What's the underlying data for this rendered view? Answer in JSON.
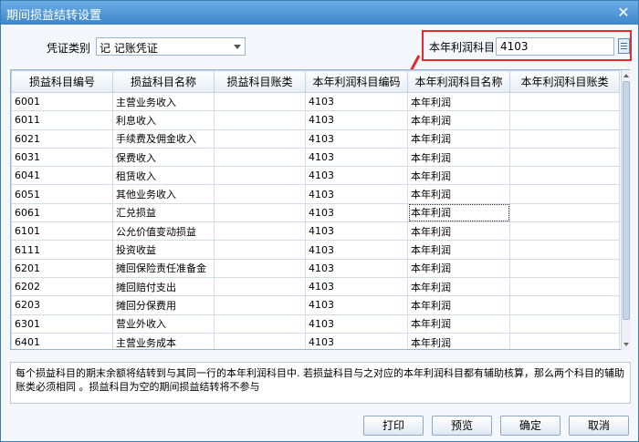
{
  "window": {
    "title": "期间损益结转设置",
    "close_glyph": "✕"
  },
  "voucher": {
    "label": "凭证类别",
    "value": "记 记账凭证"
  },
  "profit_account": {
    "label": "本年利润科目",
    "value": "4103"
  },
  "table": {
    "columns": [
      "损益科目编号",
      "损益科目名称",
      "损益科目账类",
      "本年利润科目编码",
      "本年利润科目名称",
      "本年利润科目账类"
    ],
    "rows": [
      [
        "6001",
        "主营业务收入",
        "",
        "4103",
        "本年利润",
        ""
      ],
      [
        "6011",
        "利息收入",
        "",
        "4103",
        "本年利润",
        ""
      ],
      [
        "6021",
        "手续费及佣金收入",
        "",
        "4103",
        "本年利润",
        ""
      ],
      [
        "6031",
        "保费收入",
        "",
        "4103",
        "本年利润",
        ""
      ],
      [
        "6041",
        "租赁收入",
        "",
        "4103",
        "本年利润",
        ""
      ],
      [
        "6051",
        "其他业务收入",
        "",
        "4103",
        "本年利润",
        ""
      ],
      [
        "6061",
        "汇兑损益",
        "",
        "4103",
        "本年利润",
        ""
      ],
      [
        "6101",
        "公允价值变动损益",
        "",
        "4103",
        "本年利润",
        ""
      ],
      [
        "6111",
        "投资收益",
        "",
        "4103",
        "本年利润",
        ""
      ],
      [
        "6201",
        "摊回保险责任准备金",
        "",
        "4103",
        "本年利润",
        ""
      ],
      [
        "6202",
        "摊回赔付支出",
        "",
        "4103",
        "本年利润",
        ""
      ],
      [
        "6203",
        "摊回分保费用",
        "",
        "4103",
        "本年利润",
        ""
      ],
      [
        "6301",
        "营业外收入",
        "",
        "4103",
        "本年利润",
        ""
      ],
      [
        "6401",
        "主营业务成本",
        "",
        "4103",
        "本年利润",
        ""
      ]
    ]
  },
  "note": "每个损益科目的期末余额将结转到与其同一行的本年利润科目中. 若损益科目与之对应的本年利润科目都有辅助核算，那么两个科目的辅助账类必须相同 。损益科目为空的期间损益结转将不参与",
  "buttons": {
    "print": "打印",
    "preview": "预览",
    "ok": "确定",
    "cancel": "取消"
  },
  "colors": {
    "titlebar": "#3f86c9",
    "annotation": "#e52a2a"
  }
}
